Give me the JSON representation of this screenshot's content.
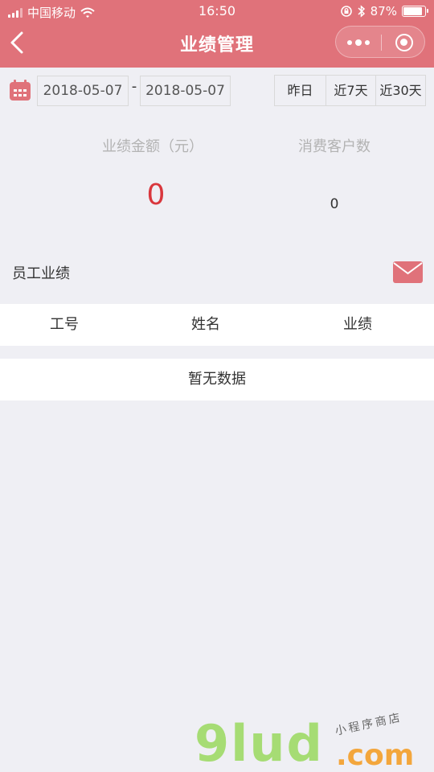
{
  "status_bar": {
    "carrier": "中国移动",
    "time": "16:50",
    "battery_percent": "87%",
    "battery_level": 0.87
  },
  "nav": {
    "title": "业绩管理"
  },
  "filters": {
    "start_date": "2018-05-07",
    "separator": "-",
    "end_date": "2018-05-07",
    "ranges": [
      "昨日",
      "近7天",
      "近30天"
    ]
  },
  "stats": {
    "amount_label": "业绩金额（元）",
    "amount_value": "0",
    "customers_label": "消费客户数",
    "customers_value": "0"
  },
  "section": {
    "title": "员工业绩"
  },
  "table": {
    "columns": [
      "工号",
      "姓名",
      "业绩"
    ],
    "empty_text": "暂无数据"
  },
  "watermark": {
    "logo": "9lud",
    "tagline": "小程序商店",
    "suffix": ".com"
  },
  "colors": {
    "header": "#e0727a",
    "accent_red": "#d9373d",
    "background": "#efeff4",
    "watermark_green": "#a6dc74",
    "watermark_orange": "#f3a63c"
  }
}
